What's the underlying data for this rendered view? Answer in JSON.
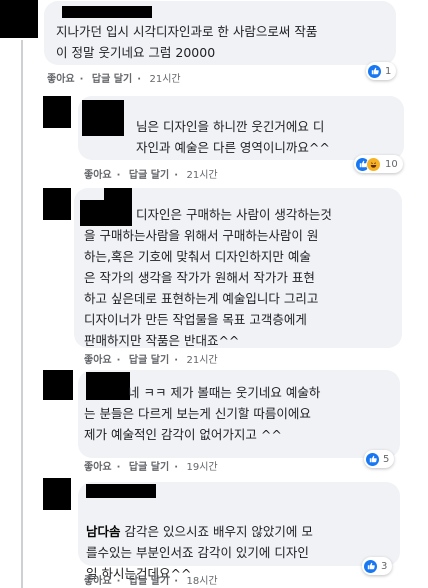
{
  "comments": [
    {
      "text": "지나가던 입시 시각디자인과로 한 사람으로써 작품\n이 정말 웃기네요 그럼 20000",
      "like": "좋아요",
      "reply": "답글 달기",
      "time": "21시간",
      "reactions": {
        "count": "1",
        "icons": [
          "like-icon"
        ]
      }
    },
    {
      "text": "님은 디자인을 하니깐 웃긴거에요 디\n자인과 예술은 다른 영역이니까요^^",
      "like": "좋아요",
      "reply": "답글 달기",
      "time": "21시간",
      "reactions": {
        "count": "10",
        "icons": [
          "like-icon",
          "haha-icon"
        ]
      }
    },
    {
      "text": "디자인은 구매하는 사람이 생각하는것\n을 구매하는사람을 위해서 구매하는사람이 원\n하는,혹은 기호에 맞춰서 디자인하지만 예술\n은 작가의 생각을 작가가 원해서 작가가 표현\n하고 싶은데로 표현하는게 예술입니다 그리고\n디자이너가 만든 작업물을 목표 고객층에게\n판매하지만 작품은 반대죠^^",
      "like": "좋아요",
      "reply": "답글 달기",
      "time": "21시간",
      "reactions": null
    },
    {
      "text": "네 ㅋㅋ 제가 볼때는 웃기네요 예술하\n는 분들은 다르게 보는게 신기할 따름이에요\n제가 예술적인 감각이 없어가지고 ^^",
      "like": "좋아요",
      "reply": "답글 달기",
      "time": "19시간",
      "reactions": {
        "count": "5",
        "icons": [
          "like-icon"
        ]
      }
    },
    {
      "name": "남다솜",
      "text": "감각은 있으시죠 배우지 않았기에 모\n를수있는 부분인서죠 감각이 있기에 디자인\n일 하시는건데요^^",
      "like": "좋아요",
      "reply": "답글 달기",
      "time": "18시간",
      "reactions": {
        "count": "3",
        "icons": [
          "like-icon"
        ]
      }
    }
  ],
  "colors": {
    "like_blue": "#1877f2",
    "haha_yellow": "#f7b125",
    "bubble": "#f0f2f5",
    "meta_gray": "#65676b"
  }
}
